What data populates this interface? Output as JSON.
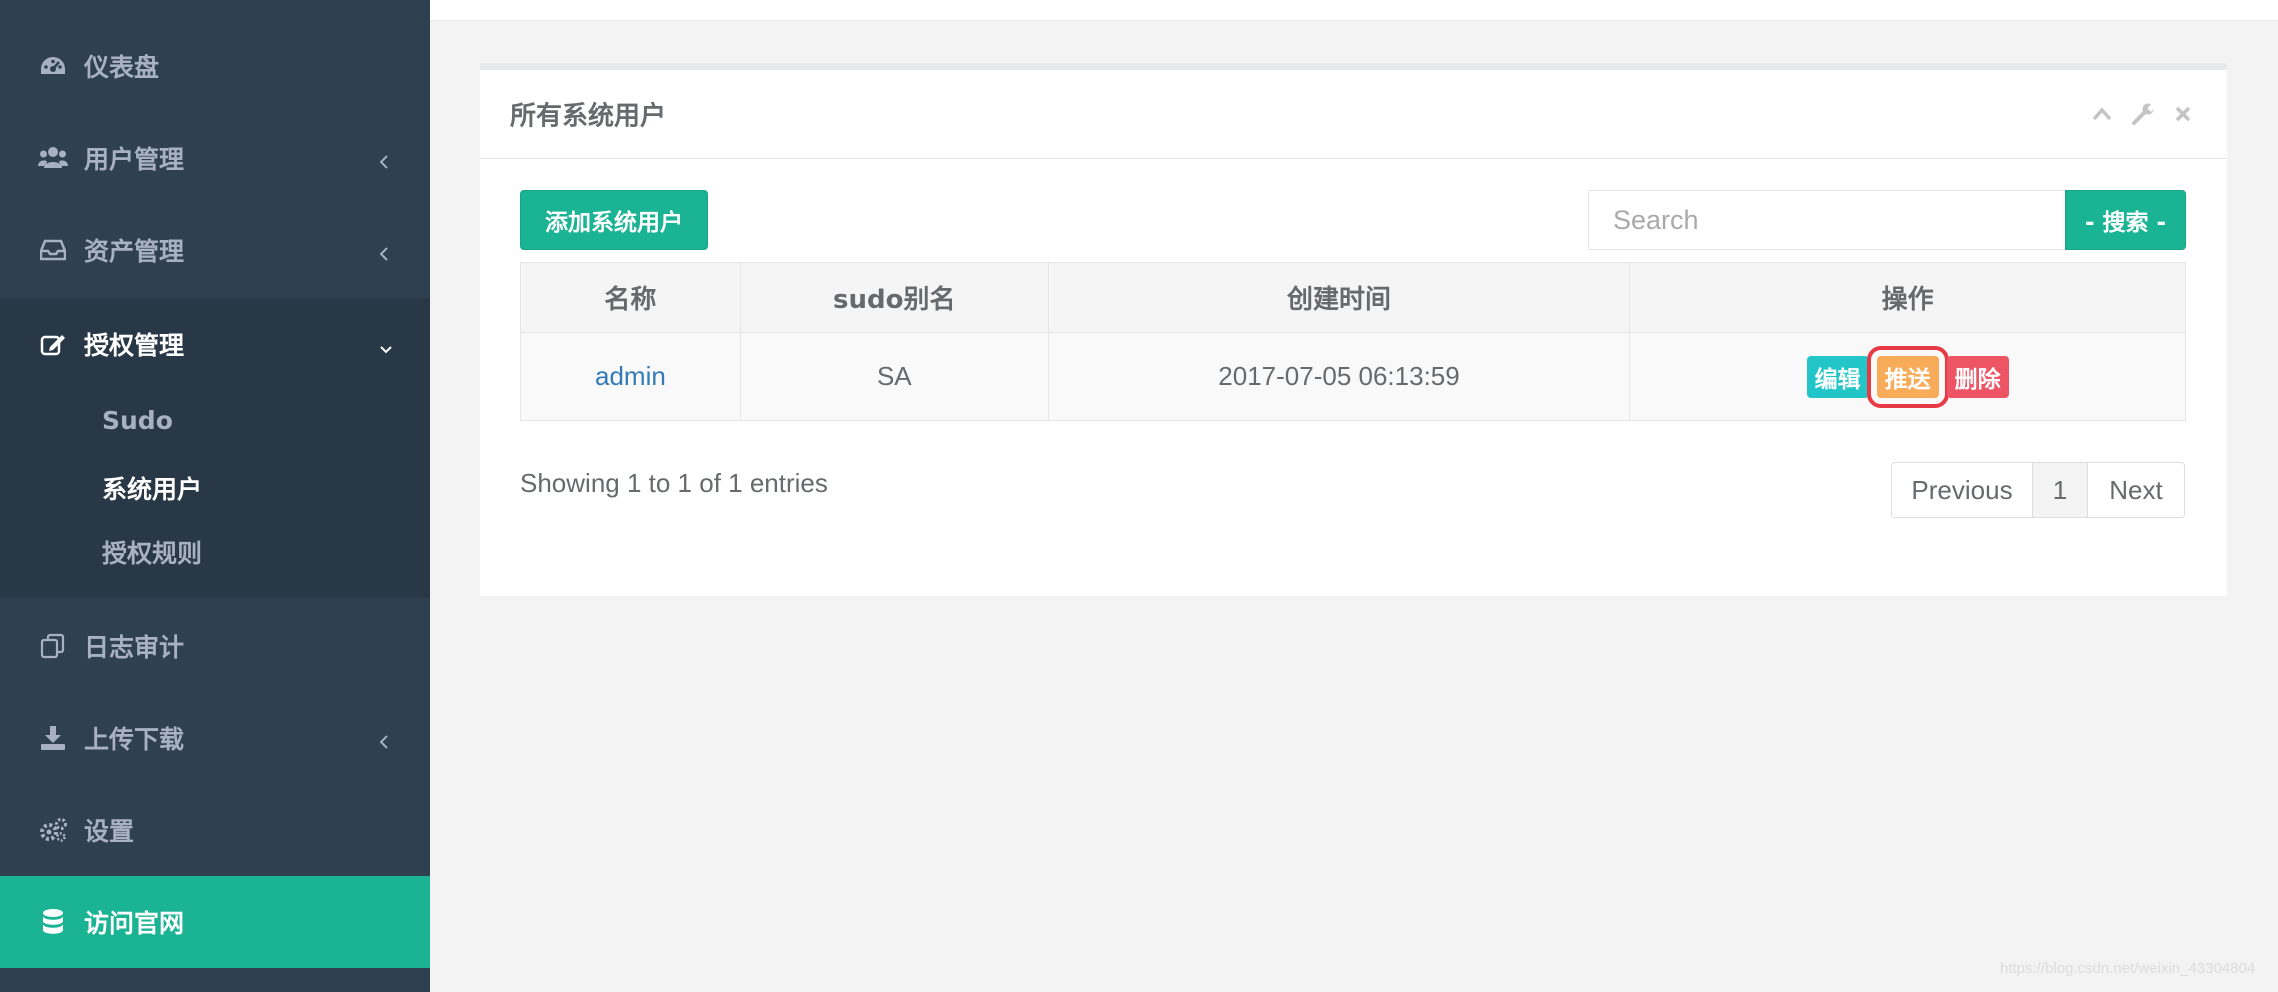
{
  "sidebar": {
    "items": [
      {
        "label": "仪表盘",
        "icon": "dashboard-icon"
      },
      {
        "label": "用户管理",
        "icon": "users-icon"
      },
      {
        "label": "资产管理",
        "icon": "inbox-icon"
      },
      {
        "label": "授权管理",
        "icon": "edit-icon"
      },
      {
        "label": "日志审计",
        "icon": "copy-icon"
      },
      {
        "label": "上传下载",
        "icon": "download-icon"
      },
      {
        "label": "设置",
        "icon": "gears-icon"
      },
      {
        "label": "访问官网",
        "icon": "database-icon"
      }
    ],
    "submenu": [
      "Sudo",
      "系统用户",
      "授权规则"
    ],
    "active_submenu": "系统用户",
    "colors": {
      "bg": "#2f4050",
      "active_bg": "#293846",
      "accent": "#1ab394"
    }
  },
  "panel": {
    "title": "所有系统用户",
    "add_button": "添加系统用户",
    "search": {
      "placeholder": "Search",
      "value": "",
      "button": "- 搜索 -"
    },
    "table": {
      "columns": [
        "名称",
        "sudo别名",
        "创建时间",
        "操作"
      ],
      "rows": [
        {
          "name": "admin",
          "sudo": "SA",
          "created": "2017-07-05 06:13:59"
        }
      ],
      "actions": {
        "edit": "编辑",
        "push": "推送",
        "delete": "删除"
      }
    },
    "info": "Showing 1 to 1 of 1 entries",
    "pagination": {
      "previous": "Previous",
      "page": "1",
      "next": "Next"
    }
  },
  "watermark": "https://blog.csdn.net/weixin_43304804"
}
